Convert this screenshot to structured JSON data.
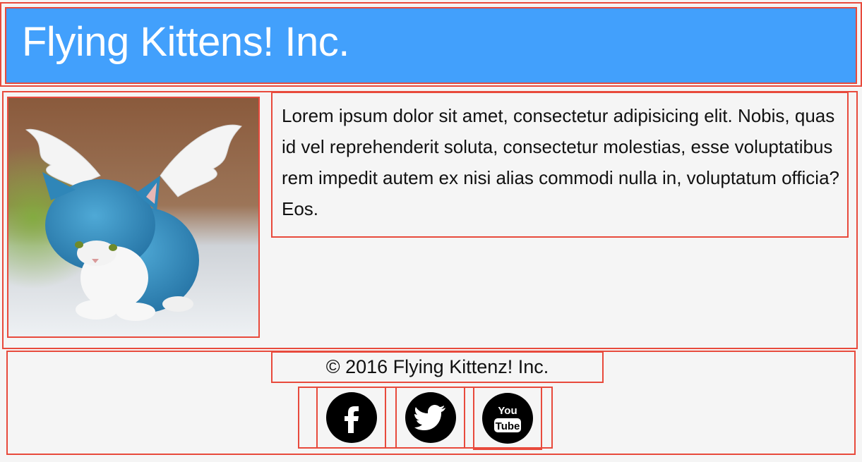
{
  "header": {
    "title": "Flying Kittens! Inc."
  },
  "main": {
    "image_alt": "flying blue kitten with white wings",
    "paragraph": "Lorem ipsum dolor sit amet, consectetur adipisicing elit. Nobis, quas id vel reprehenderit soluta, consectetur molestias, esse voluptatibus rem impedit autem ex nisi alias commodi nulla in, voluptatum officia? Eos."
  },
  "footer": {
    "copyright": "© 2016 Flying Kittenz! Inc.",
    "social": [
      {
        "name": "facebook",
        "icon": "facebook-icon"
      },
      {
        "name": "twitter",
        "icon": "twitter-icon"
      },
      {
        "name": "youtube",
        "icon": "youtube-icon",
        "label_top": "You",
        "label_bottom": "Tube"
      }
    ]
  },
  "colors": {
    "header_bg": "#42a0fc",
    "outline": "#e84a3c",
    "page_bg": "#f5f5f5"
  }
}
